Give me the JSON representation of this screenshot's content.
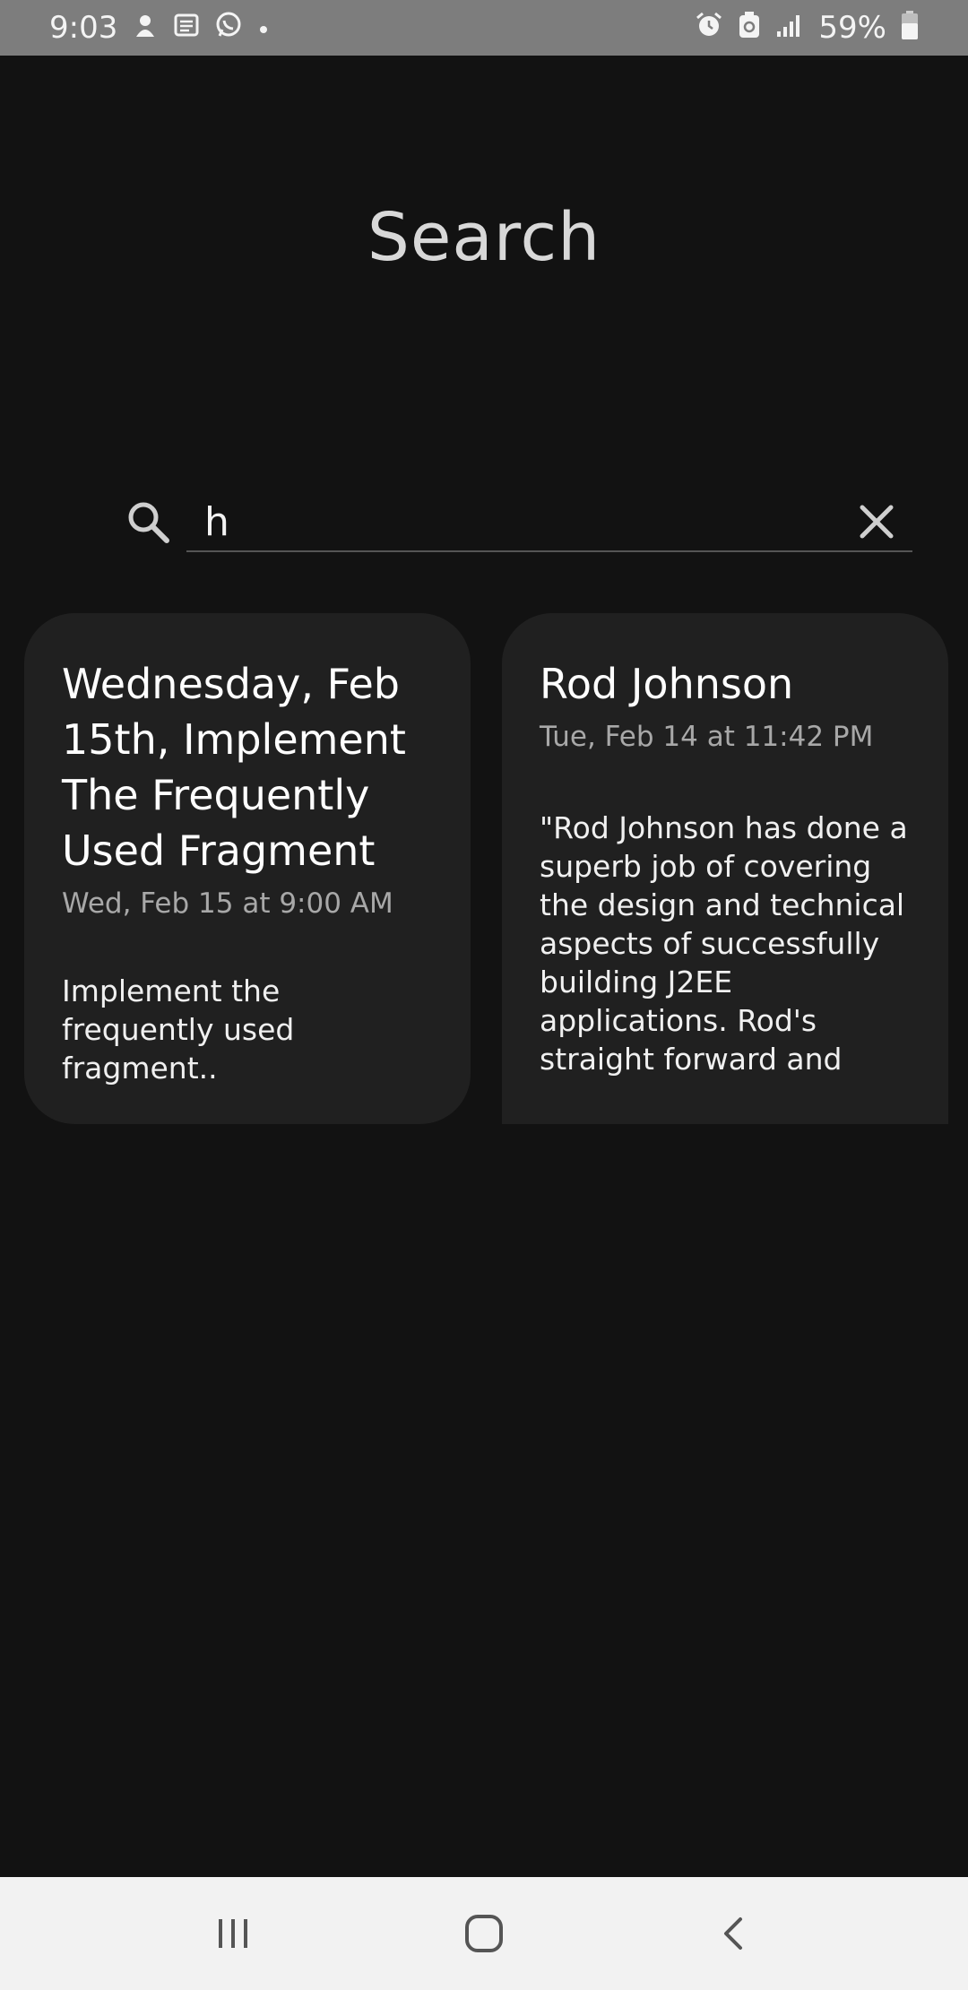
{
  "status_bar": {
    "time": "9:03",
    "battery": "59%",
    "left_icons": [
      "pocket-icon",
      "news-icon",
      "whatsapp-icon",
      "dot-icon"
    ],
    "right_icons": [
      "alarm-icon",
      "battery-saver-icon",
      "signal-icon",
      "battery-icon"
    ]
  },
  "header": {
    "title": "Search"
  },
  "search": {
    "query": "h"
  },
  "results": [
    {
      "title": "Wednesday, Feb 15th, Implement The Frequently Used Fragment",
      "date": "Wed, Feb 15 at 9:00 AM",
      "body": "Implement the frequently used fragment.."
    },
    {
      "title": "Rod Johnson",
      "date": "Tue, Feb 14 at 11:42 PM",
      "body": "\"Rod Johnson has done a superb job of covering the design and technical aspects of successfully building J2EE applications. Rod's straight forward and"
    }
  ],
  "nav_bar": {
    "buttons": [
      "recent-apps-icon",
      "home-icon",
      "back-icon"
    ]
  },
  "colors": {
    "background": "#121212",
    "card": "#202020",
    "status_bar": "#7d7d7d",
    "nav_bar": "#f2f2f2",
    "highlight": "#cfcfcf"
  }
}
